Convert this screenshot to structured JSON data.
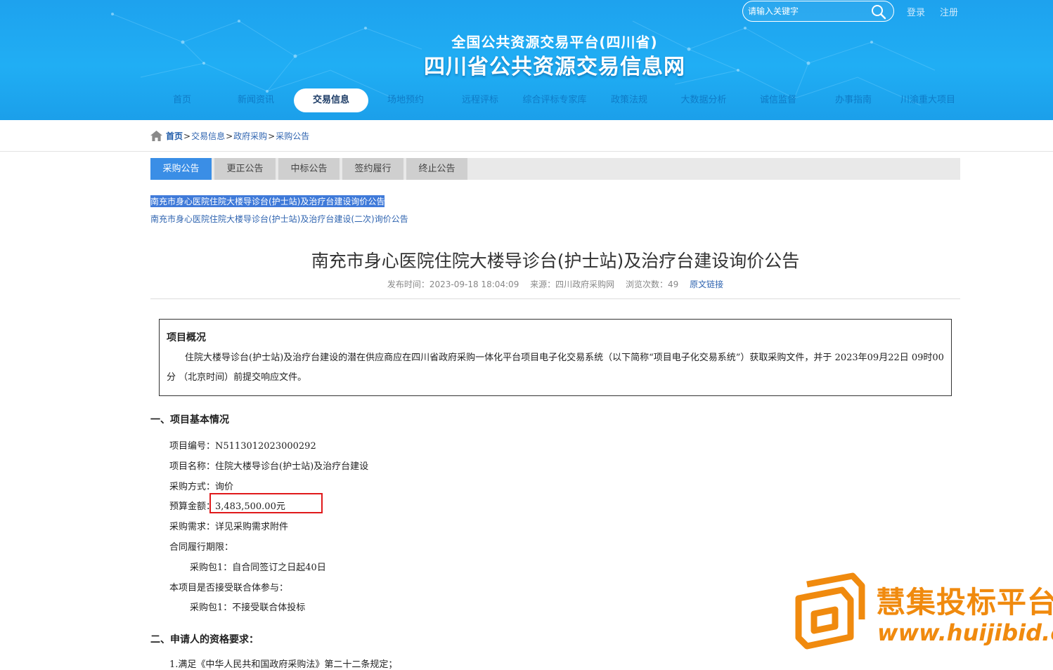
{
  "header": {
    "search": {
      "placeholder": "请输入关键字"
    },
    "login": "登录",
    "register": "注册",
    "subtitle": "全国公共资源交易平台(四川省)",
    "title": "四川省公共资源交易信息网"
  },
  "nav": [
    {
      "label": "首页"
    },
    {
      "label": "新闻资讯"
    },
    {
      "label": "交易信息",
      "active": true
    },
    {
      "label": "场地预约"
    },
    {
      "label": "远程评标"
    },
    {
      "label": "综合评标专家库"
    },
    {
      "label": "政策法规"
    },
    {
      "label": "大数据分析"
    },
    {
      "label": "诚信监督"
    },
    {
      "label": "办事指南"
    },
    {
      "label": "川渝重大项目"
    }
  ],
  "breadcrumb": {
    "home": "首页",
    "sep": ">",
    "l1": "交易信息",
    "l2": "政府采购",
    "l3": "采购公告"
  },
  "tabs": [
    {
      "label": "采购公告",
      "active": true
    },
    {
      "label": "更正公告"
    },
    {
      "label": "中标公告"
    },
    {
      "label": "签约履行"
    },
    {
      "label": "终止公告"
    }
  ],
  "related": [
    "南充市身心医院住院大楼导诊台(护士站)及治疗台建设询价公告",
    "南充市身心医院住院大楼导诊台(护士站)及治疗台建设(二次)询价公告"
  ],
  "article": {
    "title": "南充市身心医院住院大楼导诊台(护士站)及治疗台建设询价公告",
    "publish_time": "发布时间：2023-09-18 18:04:09",
    "source": "来源：四川政府采购网",
    "views": "浏览次数：49",
    "source_link": "原文链接"
  },
  "overview": {
    "title": "项目概况",
    "text": "住院大楼导诊台(护士站)及治疗台建设的潜在供应商应在四川省政府采购一体化平台项目电子化交易系统（以下简称“项目电子化交易系统”）获取采购文件，并于 2023年09月22日 09时00分 （北京时间）前提交响应文件。"
  },
  "section1": {
    "title": "一、项目基本情况",
    "project_no": "项目编号：N5113012023000292",
    "project_name": "项目名称：住院大楼导诊台(护士站)及治疗台建设",
    "method": "采购方式：询价",
    "budget": "预算金额：3,483,500.00元",
    "requirement": "采购需求：详见采购需求附件",
    "period_label": "合同履行期限：",
    "period_pkg": "采购包1：自合同签订之日起40日",
    "consortium_label": "本项目是否接受联合体参与：",
    "consortium_pkg": "采购包1：不接受联合体投标"
  },
  "section2": {
    "title": "二、申请人的资格要求：",
    "item1": "1.满足《中华人民共和国政府采购法》第二十二条规定；"
  },
  "watermark": {
    "cn": "慧集投标平台",
    "en": "www.huijibid.cn"
  },
  "colors": {
    "header_blue": "#20aef4",
    "tab_active": "#3a8ee6",
    "highlight_red": "#e0191b",
    "watermark_orange": "#f08a0e"
  }
}
